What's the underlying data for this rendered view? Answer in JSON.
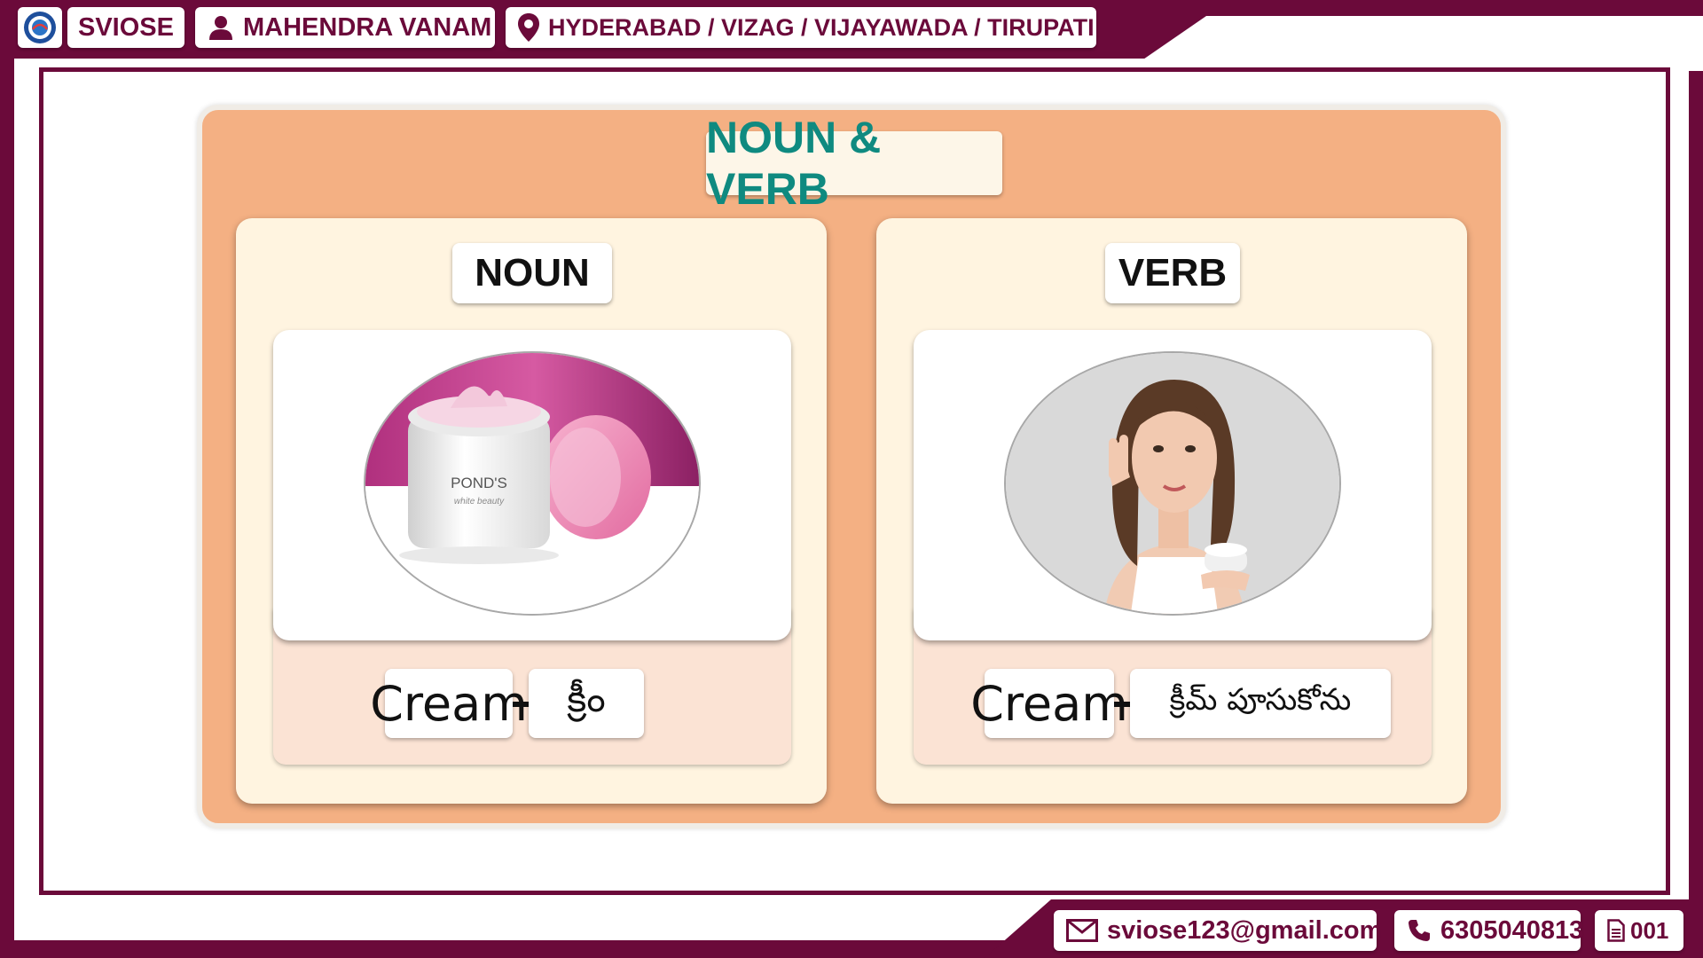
{
  "header": {
    "brand": "SVIOSE",
    "person": "MAHENDRA VANAM",
    "locations": "HYDERABAD / VIZAG / VIJAYAWADA / TIRUPATI"
  },
  "title": "NOUN & VERB",
  "panels": [
    {
      "heading": "NOUN",
      "image_alt": "pond's cream jar",
      "word_en": "Cream",
      "word_te": "క్రీం"
    },
    {
      "heading": "VERB",
      "image_alt": "woman applying cream",
      "word_en": "Cream",
      "word_te": "క్రీమ్ పూసుకోను"
    }
  ],
  "jar_brand": "POND'S",
  "jar_sub": "white beauty",
  "footer": {
    "email": "sviose123@gmail.com",
    "phone": "6305040813",
    "page": "001"
  },
  "colors": {
    "brand_maroon": "#6b0a3a",
    "card_orange": "#f4b083",
    "title_teal": "#0f8a80"
  }
}
